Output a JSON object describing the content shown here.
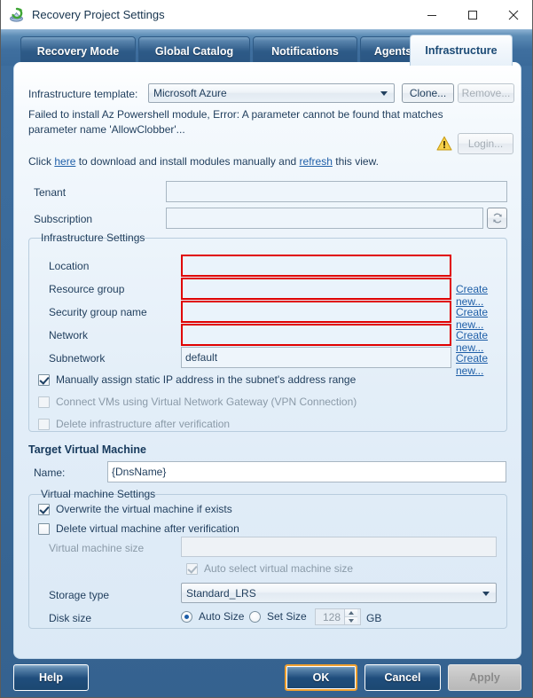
{
  "window": {
    "title": "Recovery Project Settings",
    "icon": "recovery-app-icon",
    "minimize": "─",
    "maximize": "□",
    "close": "✕"
  },
  "tabs": [
    {
      "label": "Recovery Mode",
      "selected": false
    },
    {
      "label": "Global Catalog",
      "selected": false
    },
    {
      "label": "Notifications",
      "selected": false
    },
    {
      "label": "Agents",
      "selected": false
    },
    {
      "label": "Infrastructure",
      "selected": true
    }
  ],
  "template_row": {
    "label": "Infrastructure template:",
    "value": "Microsoft Azure",
    "clone_label": "Clone...",
    "remove_label": "Remove..."
  },
  "status": {
    "error_line1": "Failed to install Az Powershell module, Error: A parameter cannot be found that matches",
    "error_line2": "parameter name 'AllowClobber'...",
    "hint_prefix": "Click ",
    "hint_link1": "here",
    "hint_middle": " to download and install modules manually and ",
    "hint_link2": "refresh",
    "hint_suffix": " this view.",
    "warning_icon": "warning-triangle-icon",
    "login_label": "Login..."
  },
  "account": {
    "tenant_label": "Tenant",
    "tenant_value": "",
    "subscription_label": "Subscription",
    "subscription_value": "",
    "refresh_icon": "refresh-icon"
  },
  "infrastructure_settings": {
    "title": "Infrastructure Settings",
    "fields": [
      {
        "label": "Location",
        "value": "",
        "error": true,
        "link": ""
      },
      {
        "label": "Resource group",
        "value": "",
        "error": true,
        "link": "Create new..."
      },
      {
        "label": "Security group name",
        "value": "",
        "error": true,
        "link": "Create new..."
      },
      {
        "label": "Network",
        "value": "",
        "error": true,
        "link": "Create new..."
      },
      {
        "label": "Subnetwork",
        "value": "default",
        "error": false,
        "link": "Create new..."
      }
    ],
    "checkboxes": [
      {
        "label": "Manually assign static IP address in the subnet's address range",
        "checked": true,
        "enabled": true
      },
      {
        "label": "Connect VMs using Virtual Network Gateway (VPN Connection)",
        "checked": false,
        "enabled": false
      },
      {
        "label": "Delete infrastructure after verification",
        "checked": false,
        "enabled": false
      }
    ]
  },
  "target_vm": {
    "heading": "Target Virtual Machine",
    "name_label": "Name:",
    "name_value": "{DnsName}"
  },
  "vm_settings": {
    "title": "Virtual machine Settings",
    "checkboxes": [
      {
        "label": "Overwrite the virtual machine if exists",
        "checked": true,
        "enabled": true
      },
      {
        "label": "Delete virtual machine after verification",
        "checked": false,
        "enabled": true
      }
    ],
    "vm_size_label": "Virtual machine size",
    "vm_size_value": "",
    "auto_select_label": "Auto select virtual machine size",
    "auto_select_checked": true,
    "storage_type_label": "Storage type",
    "storage_type_value": "Standard_LRS",
    "disk_size_label": "Disk size",
    "auto_size_label": "Auto Size",
    "set_size_label": "Set Size",
    "disk_size_value": "128",
    "disk_size_unit": "GB",
    "disk_mode": "auto"
  },
  "footer": {
    "help_label": "Help",
    "ok_label": "OK",
    "cancel_label": "Cancel",
    "apply_label": "Apply"
  },
  "colors": {
    "accent_blue": "#3a6a9a",
    "error_red": "#e00000",
    "link_blue": "#1f5fa8",
    "focus_orange": "#f0a030",
    "warning_yellow": "#f5c518"
  }
}
